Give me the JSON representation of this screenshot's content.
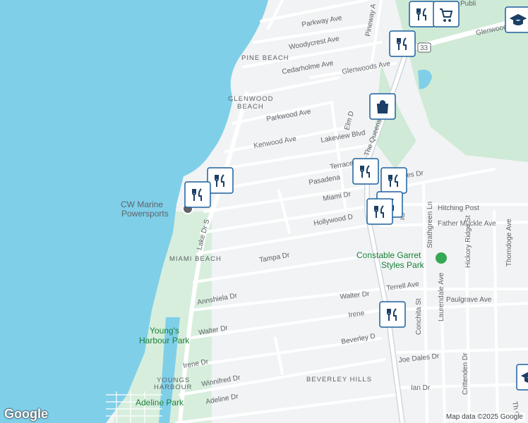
{
  "streets": {
    "parkway": "Parkway Ave",
    "woodycrest": "Woodycrest Ave",
    "cedarholme": "Cedarholme Ave",
    "glenwoods1": "Glenwoods Ave",
    "glenwoods2": "Glenwoods Ave",
    "parkwood": "Parkwood Ave",
    "kenwood": "Kenwood Ave",
    "lakeview": "Lakeview Blvd",
    "terrace": "Terrace Dr",
    "pasadena": "Pasadena",
    "miami": "Miami Dr",
    "hollywood": "Hollywood D",
    "tampa": "Tampa Dr",
    "annshiela": "Annshiela Dr",
    "walter1": "Walter Dr",
    "walter2": "Walter Dr",
    "irene1": "Irene Dr",
    "irene2": "Irene",
    "winnifred": "Winnifred Dr",
    "adeline": "Adeline Dr",
    "beverley": "Beverley D",
    "joedales": "Joe Dales Dr",
    "ian": "Ian Dr",
    "terrell": "Terrell Ave",
    "paulgrave": "Paulgrave Ave",
    "hitching": "Hitching Post",
    "fathermuckle": "Father Muckle Ave",
    "styles": "Styles Dr",
    "guy": "Guy Dr",
    "lakedr": "Lake Dr S",
    "queensway": "The Queensway S",
    "pineway": "Pineway A",
    "elmdr": "Elm D",
    "strathgreen": "Strathgreen Ln",
    "laurendale": "Laurendale Ave",
    "hickory": "Hickory Ridge St",
    "thorn": "Thorndoge Ave",
    "conchita": "Conchita St",
    "crittenden": "Crittenden Dr",
    "route": "33",
    "glenwoodsMain": "Glenwoods",
    "publi": "Publi",
    "thc": "Th C"
  },
  "neighborhoods": {
    "pine": "PINE BEACH",
    "glen1": "GLENWOOD",
    "glen2": "BEACH",
    "miami": "MIAMI BEACH",
    "beverley": "BEVERLEY HILLS",
    "youngs1": "YOUNGS",
    "youngs2": "HARBOUR"
  },
  "parks": {
    "constable1": "Constable Garret",
    "constable2": "Styles Park",
    "youngs1": "Young's",
    "youngs2": "Harbour Park",
    "adeline": "Adeline Park"
  },
  "poi": {
    "cw1": "CW Marine",
    "cw2": "Powersports"
  },
  "colors": {
    "water": "#7fcfe9",
    "land": "#f1f3f4",
    "park": "#cfead6",
    "road": "#ffffff",
    "highway": "#cfd8dc",
    "marker": "#1c5f9e"
  },
  "markers": [
    {
      "icon": "fork-knife-icon"
    },
    {
      "icon": "fork-knife-icon"
    },
    {
      "icon": "fork-knife-icon"
    },
    {
      "icon": "fork-knife-icon"
    },
    {
      "icon": "fork-knife-icon"
    },
    {
      "icon": "fork-knife-icon"
    },
    {
      "icon": "fork-knife-icon"
    },
    {
      "icon": "fork-knife-icon"
    },
    {
      "icon": "fork-knife-icon"
    },
    {
      "icon": "shopping-bag-icon"
    },
    {
      "icon": "shopping-cart-icon"
    },
    {
      "icon": "graduation-cap-icon"
    },
    {
      "icon": "graduation-cap-icon"
    }
  ],
  "attribution": "Map data ©2025 Google",
  "logo": "Google"
}
